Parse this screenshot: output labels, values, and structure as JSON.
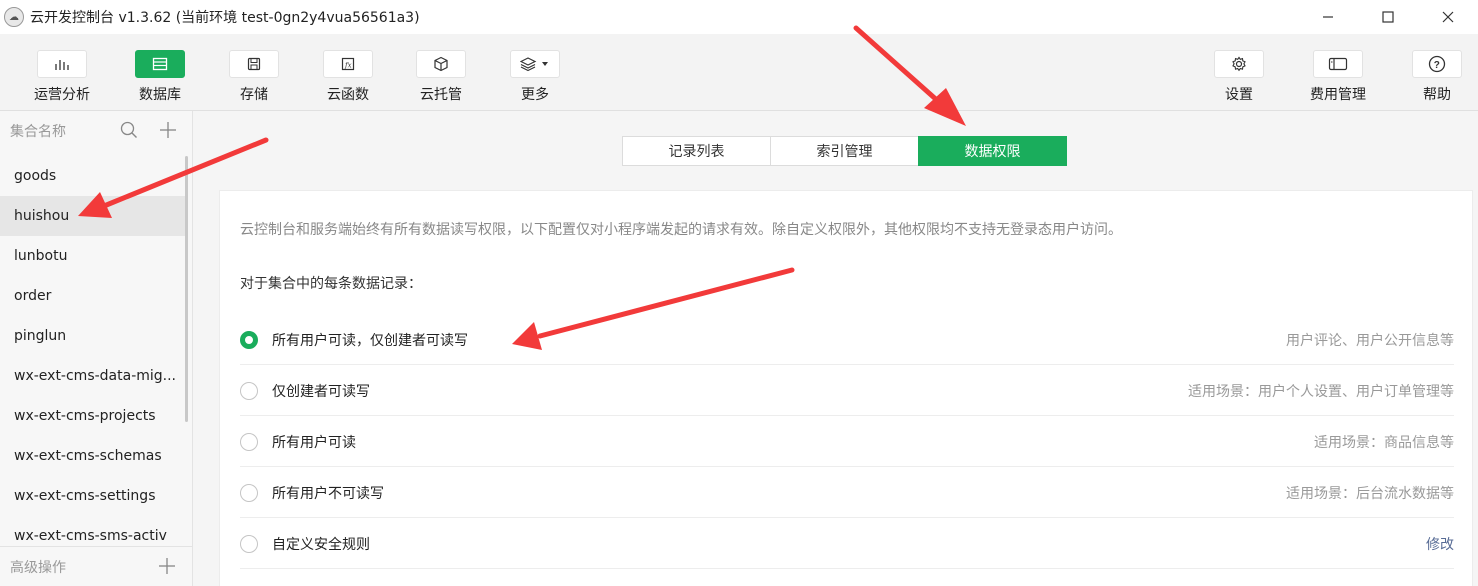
{
  "window": {
    "title": "云开发控制台 v1.3.62  (当前环境 test-0gn2y4vua56561a3)"
  },
  "toolbar": {
    "items": [
      {
        "label": "运营分析",
        "icon": "bar-chart-icon"
      },
      {
        "label": "数据库",
        "icon": "database-icon",
        "active": true
      },
      {
        "label": "存储",
        "icon": "save-icon"
      },
      {
        "label": "云函数",
        "icon": "function-icon"
      },
      {
        "label": "云托管",
        "icon": "cube-icon"
      },
      {
        "label": "更多",
        "icon": "layers-icon"
      }
    ],
    "right_items": [
      {
        "label": "设置",
        "icon": "gear-icon"
      },
      {
        "label": "费用管理",
        "icon": "billing-icon"
      },
      {
        "label": "帮助",
        "icon": "help-icon"
      }
    ]
  },
  "sidebar": {
    "header": "集合名称",
    "collections": [
      "goods",
      "huishou",
      "lunbotu",
      "order",
      "pinglun",
      "wx-ext-cms-data-mig...",
      "wx-ext-cms-projects",
      "wx-ext-cms-schemas",
      "wx-ext-cms-settings",
      "wx-ext-cms-sms-activ"
    ],
    "selected": "huishou",
    "footer": "高级操作"
  },
  "tabs": [
    {
      "label": "记录列表"
    },
    {
      "label": "索引管理"
    },
    {
      "label": "数据权限",
      "active": true
    }
  ],
  "permissions": {
    "description": "云控制台和服务端始终有所有数据读写权限，以下配置仅对小程序端发起的请求有效。除自定义权限外，其他权限均不支持无登录态用户访问。",
    "subheading": "对于集合中的每条数据记录：",
    "options": [
      {
        "label": "所有用户可读，仅创建者可读写",
        "hint": "用户评论、用户公开信息等",
        "checked": true
      },
      {
        "label": "仅创建者可读写",
        "hint": "适用场景：用户个人设置、用户订单管理等",
        "checked": false
      },
      {
        "label": "所有用户可读",
        "hint": "适用场景：商品信息等",
        "checked": false
      },
      {
        "label": "所有用户不可读写",
        "hint": "适用场景：后台流水数据等",
        "checked": false
      },
      {
        "label": "自定义安全规则",
        "hint": "修改",
        "checked": false
      }
    ]
  },
  "colors": {
    "accent": "#1aad5c",
    "annotation_arrow": "#f23a3a"
  }
}
